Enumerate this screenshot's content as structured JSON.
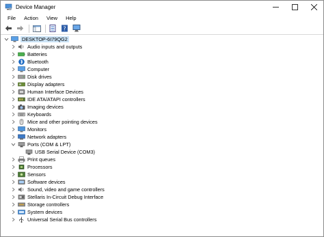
{
  "window": {
    "title": "Device Manager"
  },
  "menu": [
    "File",
    "Action",
    "View",
    "Help"
  ],
  "tree": {
    "root": "DESKTOP-6I79QG2",
    "categories": [
      {
        "label": "Audio inputs and outputs",
        "icon": "speaker-icon",
        "expanded": false
      },
      {
        "label": "Batteries",
        "icon": "battery-icon",
        "expanded": false
      },
      {
        "label": "Bluetooth",
        "icon": "bluetooth-icon",
        "expanded": false
      },
      {
        "label": "Computer",
        "icon": "computer-icon",
        "expanded": false
      },
      {
        "label": "Disk drives",
        "icon": "disk-drive-icon",
        "expanded": false
      },
      {
        "label": "Display adapters",
        "icon": "display-adapter-icon",
        "expanded": false
      },
      {
        "label": "Human Interface Devices",
        "icon": "hid-icon",
        "expanded": false
      },
      {
        "label": "IDE ATA/ATAPI controllers",
        "icon": "ide-controller-icon",
        "expanded": false
      },
      {
        "label": "Imaging devices",
        "icon": "camera-icon",
        "expanded": false
      },
      {
        "label": "Keyboards",
        "icon": "keyboard-icon",
        "expanded": false
      },
      {
        "label": "Mice and other pointing devices",
        "icon": "mouse-icon",
        "expanded": false
      },
      {
        "label": "Monitors",
        "icon": "monitor-icon",
        "expanded": false
      },
      {
        "label": "Network adapters",
        "icon": "network-adapter-icon",
        "expanded": false
      },
      {
        "label": "Ports (COM & LPT)",
        "icon": "port-icon",
        "expanded": true,
        "children": [
          {
            "label": "USB Serial Device (COM3)",
            "icon": "port-icon"
          }
        ]
      },
      {
        "label": "Print queues",
        "icon": "printer-icon",
        "expanded": false
      },
      {
        "label": "Processors",
        "icon": "processor-icon",
        "expanded": false
      },
      {
        "label": "Sensors",
        "icon": "sensor-icon",
        "expanded": false
      },
      {
        "label": "Software devices",
        "icon": "software-device-icon",
        "expanded": false
      },
      {
        "label": "Sound, video and game controllers",
        "icon": "speaker-icon",
        "expanded": false
      },
      {
        "label": "Stellaris In-Circuit Debug Interface",
        "icon": "debug-interface-icon",
        "expanded": false
      },
      {
        "label": "Storage controllers",
        "icon": "storage-controller-icon",
        "expanded": false
      },
      {
        "label": "System devices",
        "icon": "system-device-icon",
        "expanded": false
      },
      {
        "label": "Universal Serial Bus controllers",
        "icon": "usb-icon",
        "expanded": false
      }
    ]
  },
  "colors": {
    "selection": "#cce4f7",
    "accent": "#0063b1"
  }
}
